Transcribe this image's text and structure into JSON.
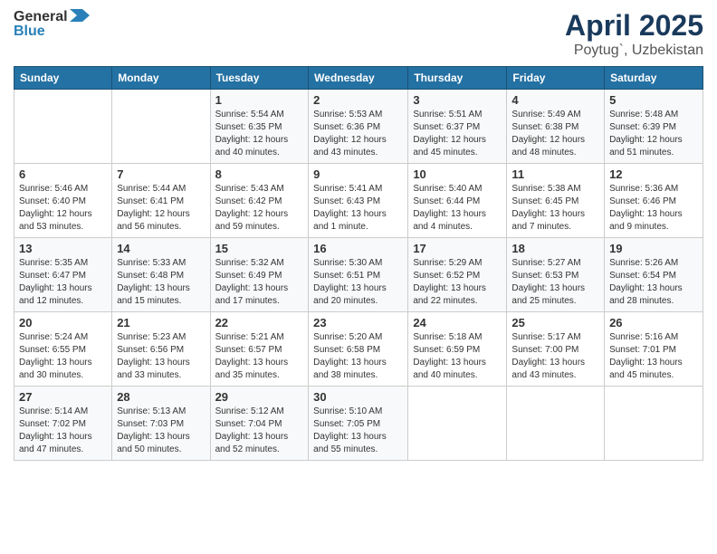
{
  "header": {
    "logo_general": "General",
    "logo_blue": "Blue",
    "title": "April 2025",
    "subtitle": "Poytug`, Uzbekistan"
  },
  "calendar": {
    "days_of_week": [
      "Sunday",
      "Monday",
      "Tuesday",
      "Wednesday",
      "Thursday",
      "Friday",
      "Saturday"
    ],
    "weeks": [
      [
        {
          "day": "",
          "info": ""
        },
        {
          "day": "",
          "info": ""
        },
        {
          "day": "1",
          "info": "Sunrise: 5:54 AM\nSunset: 6:35 PM\nDaylight: 12 hours and 40 minutes."
        },
        {
          "day": "2",
          "info": "Sunrise: 5:53 AM\nSunset: 6:36 PM\nDaylight: 12 hours and 43 minutes."
        },
        {
          "day": "3",
          "info": "Sunrise: 5:51 AM\nSunset: 6:37 PM\nDaylight: 12 hours and 45 minutes."
        },
        {
          "day": "4",
          "info": "Sunrise: 5:49 AM\nSunset: 6:38 PM\nDaylight: 12 hours and 48 minutes."
        },
        {
          "day": "5",
          "info": "Sunrise: 5:48 AM\nSunset: 6:39 PM\nDaylight: 12 hours and 51 minutes."
        }
      ],
      [
        {
          "day": "6",
          "info": "Sunrise: 5:46 AM\nSunset: 6:40 PM\nDaylight: 12 hours and 53 minutes."
        },
        {
          "day": "7",
          "info": "Sunrise: 5:44 AM\nSunset: 6:41 PM\nDaylight: 12 hours and 56 minutes."
        },
        {
          "day": "8",
          "info": "Sunrise: 5:43 AM\nSunset: 6:42 PM\nDaylight: 12 hours and 59 minutes."
        },
        {
          "day": "9",
          "info": "Sunrise: 5:41 AM\nSunset: 6:43 PM\nDaylight: 13 hours and 1 minute."
        },
        {
          "day": "10",
          "info": "Sunrise: 5:40 AM\nSunset: 6:44 PM\nDaylight: 13 hours and 4 minutes."
        },
        {
          "day": "11",
          "info": "Sunrise: 5:38 AM\nSunset: 6:45 PM\nDaylight: 13 hours and 7 minutes."
        },
        {
          "day": "12",
          "info": "Sunrise: 5:36 AM\nSunset: 6:46 PM\nDaylight: 13 hours and 9 minutes."
        }
      ],
      [
        {
          "day": "13",
          "info": "Sunrise: 5:35 AM\nSunset: 6:47 PM\nDaylight: 13 hours and 12 minutes."
        },
        {
          "day": "14",
          "info": "Sunrise: 5:33 AM\nSunset: 6:48 PM\nDaylight: 13 hours and 15 minutes."
        },
        {
          "day": "15",
          "info": "Sunrise: 5:32 AM\nSunset: 6:49 PM\nDaylight: 13 hours and 17 minutes."
        },
        {
          "day": "16",
          "info": "Sunrise: 5:30 AM\nSunset: 6:51 PM\nDaylight: 13 hours and 20 minutes."
        },
        {
          "day": "17",
          "info": "Sunrise: 5:29 AM\nSunset: 6:52 PM\nDaylight: 13 hours and 22 minutes."
        },
        {
          "day": "18",
          "info": "Sunrise: 5:27 AM\nSunset: 6:53 PM\nDaylight: 13 hours and 25 minutes."
        },
        {
          "day": "19",
          "info": "Sunrise: 5:26 AM\nSunset: 6:54 PM\nDaylight: 13 hours and 28 minutes."
        }
      ],
      [
        {
          "day": "20",
          "info": "Sunrise: 5:24 AM\nSunset: 6:55 PM\nDaylight: 13 hours and 30 minutes."
        },
        {
          "day": "21",
          "info": "Sunrise: 5:23 AM\nSunset: 6:56 PM\nDaylight: 13 hours and 33 minutes."
        },
        {
          "day": "22",
          "info": "Sunrise: 5:21 AM\nSunset: 6:57 PM\nDaylight: 13 hours and 35 minutes."
        },
        {
          "day": "23",
          "info": "Sunrise: 5:20 AM\nSunset: 6:58 PM\nDaylight: 13 hours and 38 minutes."
        },
        {
          "day": "24",
          "info": "Sunrise: 5:18 AM\nSunset: 6:59 PM\nDaylight: 13 hours and 40 minutes."
        },
        {
          "day": "25",
          "info": "Sunrise: 5:17 AM\nSunset: 7:00 PM\nDaylight: 13 hours and 43 minutes."
        },
        {
          "day": "26",
          "info": "Sunrise: 5:16 AM\nSunset: 7:01 PM\nDaylight: 13 hours and 45 minutes."
        }
      ],
      [
        {
          "day": "27",
          "info": "Sunrise: 5:14 AM\nSunset: 7:02 PM\nDaylight: 13 hours and 47 minutes."
        },
        {
          "day": "28",
          "info": "Sunrise: 5:13 AM\nSunset: 7:03 PM\nDaylight: 13 hours and 50 minutes."
        },
        {
          "day": "29",
          "info": "Sunrise: 5:12 AM\nSunset: 7:04 PM\nDaylight: 13 hours and 52 minutes."
        },
        {
          "day": "30",
          "info": "Sunrise: 5:10 AM\nSunset: 7:05 PM\nDaylight: 13 hours and 55 minutes."
        },
        {
          "day": "",
          "info": ""
        },
        {
          "day": "",
          "info": ""
        },
        {
          "day": "",
          "info": ""
        }
      ]
    ]
  }
}
